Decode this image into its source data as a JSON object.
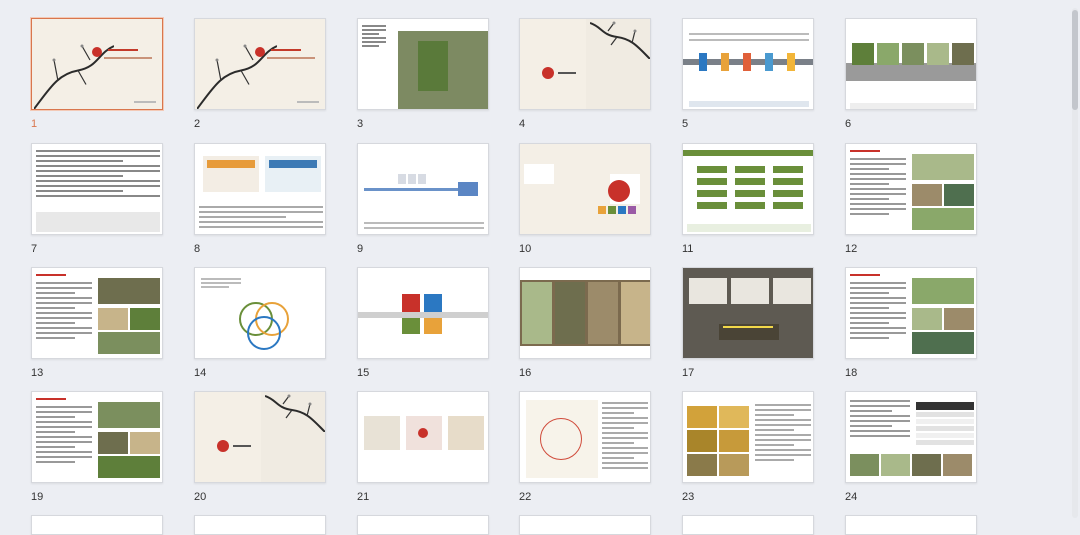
{
  "app": {
    "view": "slide-sorter"
  },
  "slides": [
    {
      "num": "1",
      "selected": true,
      "layout": "title"
    },
    {
      "num": "2",
      "selected": false,
      "layout": "title"
    },
    {
      "num": "3",
      "selected": false,
      "layout": "map"
    },
    {
      "num": "4",
      "selected": false,
      "layout": "section"
    },
    {
      "num": "5",
      "selected": false,
      "layout": "timeline"
    },
    {
      "num": "6",
      "selected": false,
      "layout": "photos"
    },
    {
      "num": "7",
      "selected": false,
      "layout": "text"
    },
    {
      "num": "8",
      "selected": false,
      "layout": "screens"
    },
    {
      "num": "9",
      "selected": false,
      "layout": "flow"
    },
    {
      "num": "10",
      "selected": false,
      "layout": "diagram"
    },
    {
      "num": "11",
      "selected": false,
      "layout": "greenboxes"
    },
    {
      "num": "12",
      "selected": false,
      "layout": "textphotos"
    },
    {
      "num": "13",
      "selected": false,
      "layout": "textphotos"
    },
    {
      "num": "14",
      "selected": false,
      "layout": "venn"
    },
    {
      "num": "15",
      "selected": false,
      "layout": "diamond"
    },
    {
      "num": "16",
      "selected": false,
      "layout": "photostrip"
    },
    {
      "num": "17",
      "selected": false,
      "layout": "darkphoto"
    },
    {
      "num": "18",
      "selected": false,
      "layout": "textphotos"
    },
    {
      "num": "19",
      "selected": false,
      "layout": "textphotos"
    },
    {
      "num": "20",
      "selected": false,
      "layout": "section"
    },
    {
      "num": "21",
      "selected": false,
      "layout": "maps3"
    },
    {
      "num": "22",
      "selected": false,
      "layout": "roadmap"
    },
    {
      "num": "23",
      "selected": false,
      "layout": "food"
    },
    {
      "num": "24",
      "selected": false,
      "layout": "table"
    }
  ],
  "colors": {
    "accent": "#d9764d",
    "seal": "#c8312a",
    "green": "#6a8f3a"
  }
}
